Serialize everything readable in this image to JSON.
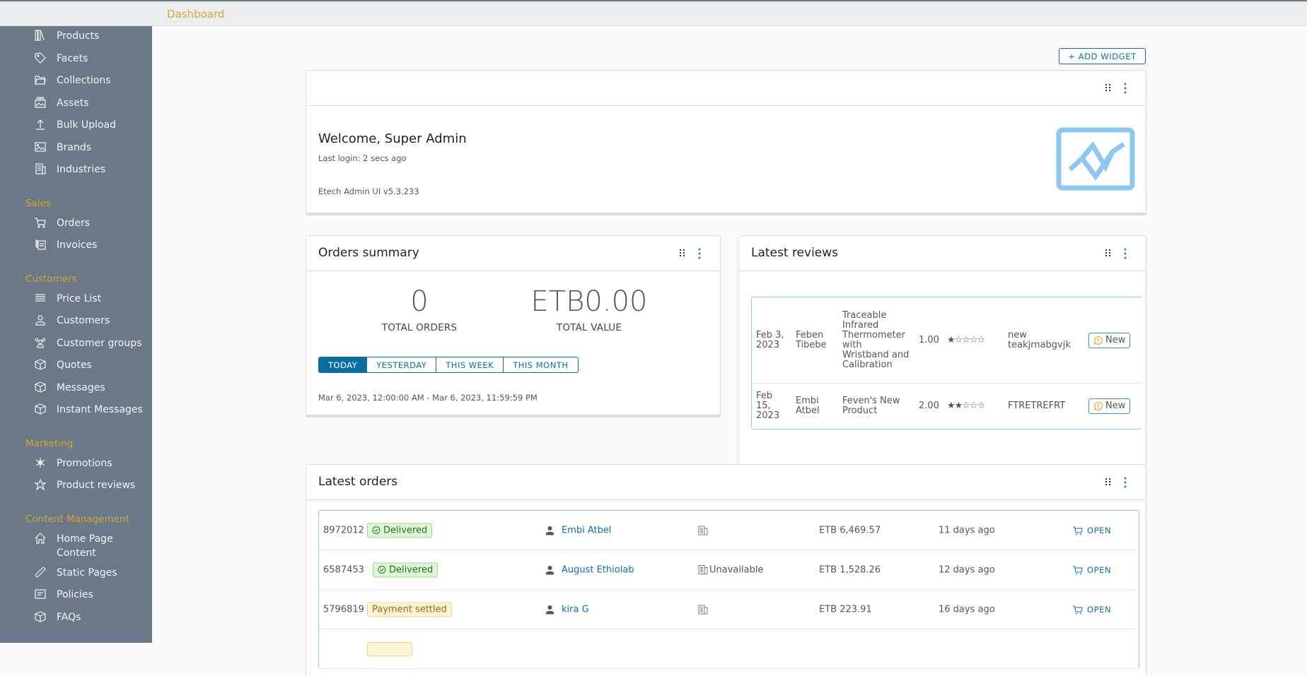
{
  "header": {
    "breadcrumb": "Dashboard"
  },
  "sidebar": {
    "items_top": [
      {
        "label": "Products",
        "icon": "library-icon"
      },
      {
        "label": "Facets",
        "icon": "tag-icon"
      },
      {
        "label": "Collections",
        "icon": "folder-icon"
      },
      {
        "label": "Assets",
        "icon": "image-gallery-icon"
      },
      {
        "label": "Bulk Upload",
        "icon": "upload-icon"
      },
      {
        "label": "Brands",
        "icon": "image-icon"
      },
      {
        "label": "Industries",
        "icon": "building-icon"
      }
    ],
    "sections": [
      {
        "title": "Sales",
        "items": [
          {
            "label": "Orders",
            "icon": "shopping-cart-icon"
          },
          {
            "label": "Invoices",
            "icon": "documents-icon"
          }
        ]
      },
      {
        "title": "Customers",
        "items": [
          {
            "label": "Price List",
            "icon": "list-icon"
          },
          {
            "label": "Customers",
            "icon": "user-icon"
          },
          {
            "label": "Customer groups",
            "icon": "users-icon"
          },
          {
            "label": "Quotes",
            "icon": "cube-icon"
          },
          {
            "label": "Messages",
            "icon": "cube-icon"
          },
          {
            "label": "Instant Messages",
            "icon": "cube-icon"
          }
        ]
      },
      {
        "title": "Marketing",
        "items": [
          {
            "label": "Promotions",
            "icon": "asterisk-icon"
          },
          {
            "label": "Product reviews",
            "icon": "star-icon"
          }
        ]
      },
      {
        "title": "Content Management",
        "items": [
          {
            "label": "Home Page Content",
            "icon": "home-icon"
          },
          {
            "label": "Static Pages",
            "icon": "paperclip-icon"
          },
          {
            "label": "Policies",
            "icon": "form-icon"
          },
          {
            "label": "FAQs",
            "icon": "cube-icon"
          }
        ]
      }
    ]
  },
  "toolbar": {
    "add_widget_label": "+ ADD WIDGET"
  },
  "welcome": {
    "title": "Welcome, Super Admin",
    "last_login": "Last login: 2 secs ago",
    "version": "Etech Admin UI v5.3.233"
  },
  "orders_summary": {
    "title": "Orders summary",
    "total_orders": "0",
    "total_orders_label": "TOTAL ORDERS",
    "total_value": "ETB0.00",
    "total_value_label": "TOTAL VALUE",
    "ranges": [
      "TODAY",
      "YESTERDAY",
      "THIS WEEK",
      "THIS MONTH"
    ],
    "active_range": "TODAY",
    "range_text": "Mar 6, 2023, 12:00:00 AM - Mar 6, 2023, 11:59:59 PM"
  },
  "latest_reviews": {
    "title": "Latest reviews",
    "rows": [
      {
        "date": "Feb 3, 2023",
        "author": "Feben Tibebe",
        "product": "Traceable Infrared Thermometer with Wristband and Calibration",
        "rating": "1.00",
        "stars": 1,
        "summary": "new teakjrnabgvjk",
        "status": "New"
      },
      {
        "date": "Feb 15, 2023",
        "author": "Embi Atbel",
        "product": "Feven's New Product",
        "rating": "2.00",
        "stars": 2,
        "summary": "FTRETREFRT",
        "status": "New"
      }
    ]
  },
  "latest_orders": {
    "title": "Latest orders",
    "open_label": "OPEN",
    "rows": [
      {
        "code": "8972012",
        "state": "Delivered",
        "state_type": "delivered",
        "customer": "Embi Atbel",
        "company": "",
        "total": "ETB 6,469.57",
        "age": "11 days ago"
      },
      {
        "code": "6587453",
        "state": "Delivered",
        "state_type": "delivered",
        "customer": "August Ethiolab",
        "company": "Unavailable",
        "total": "ETB 1,528.26",
        "age": "12 days ago"
      },
      {
        "code": "5796819",
        "state": "Payment settled",
        "state_type": "settled",
        "customer": "kira G",
        "company": "",
        "total": "ETB 223.91",
        "age": "16 days ago"
      }
    ]
  },
  "colors": {
    "accent": "#0a6ea0",
    "section_heading": "#d4a52f",
    "sidebar_bg": "#6b7888",
    "delivered_bg": "#dff7d8",
    "settled_bg": "#fff3d6"
  }
}
